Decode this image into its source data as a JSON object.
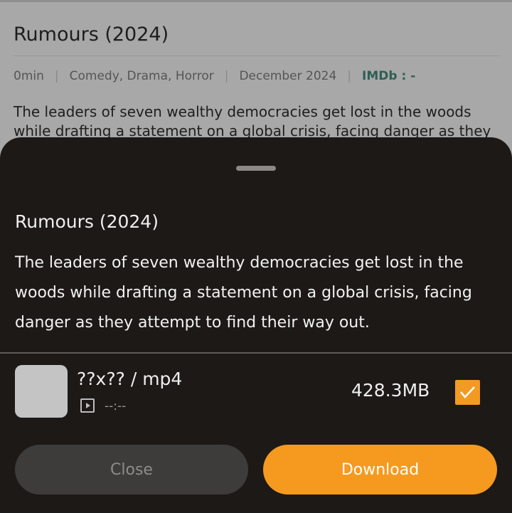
{
  "background_page": {
    "title": "Rumours (2024)",
    "duration": "0min",
    "genres": "Comedy, Drama, Horror",
    "release": "December 2024",
    "imdb": "IMDb : -",
    "description_line1": "The leaders of seven wealthy democracies get lost in the woods",
    "description_line2": "while drafting a statement on a global crisis, facing danger as they"
  },
  "sheet": {
    "title": "Rumours (2024)",
    "description_lines": [
      "The leaders of seven wealthy democracies get lost in the",
      "woods while drafting a statement on a global crisis, facing",
      "danger as they attempt to find their way out."
    ],
    "file": {
      "format": "??x?? / mp4",
      "duration": "--:--",
      "size": "428.3MB",
      "selected": true
    },
    "buttons": {
      "close": "Close",
      "download": "Download"
    }
  },
  "colors": {
    "accent": "#f59a1f",
    "sheet_background": "#1c1916",
    "close_button": "#3d3c3b"
  },
  "icons": {
    "play": "play-icon",
    "check": "checkmark-icon"
  }
}
